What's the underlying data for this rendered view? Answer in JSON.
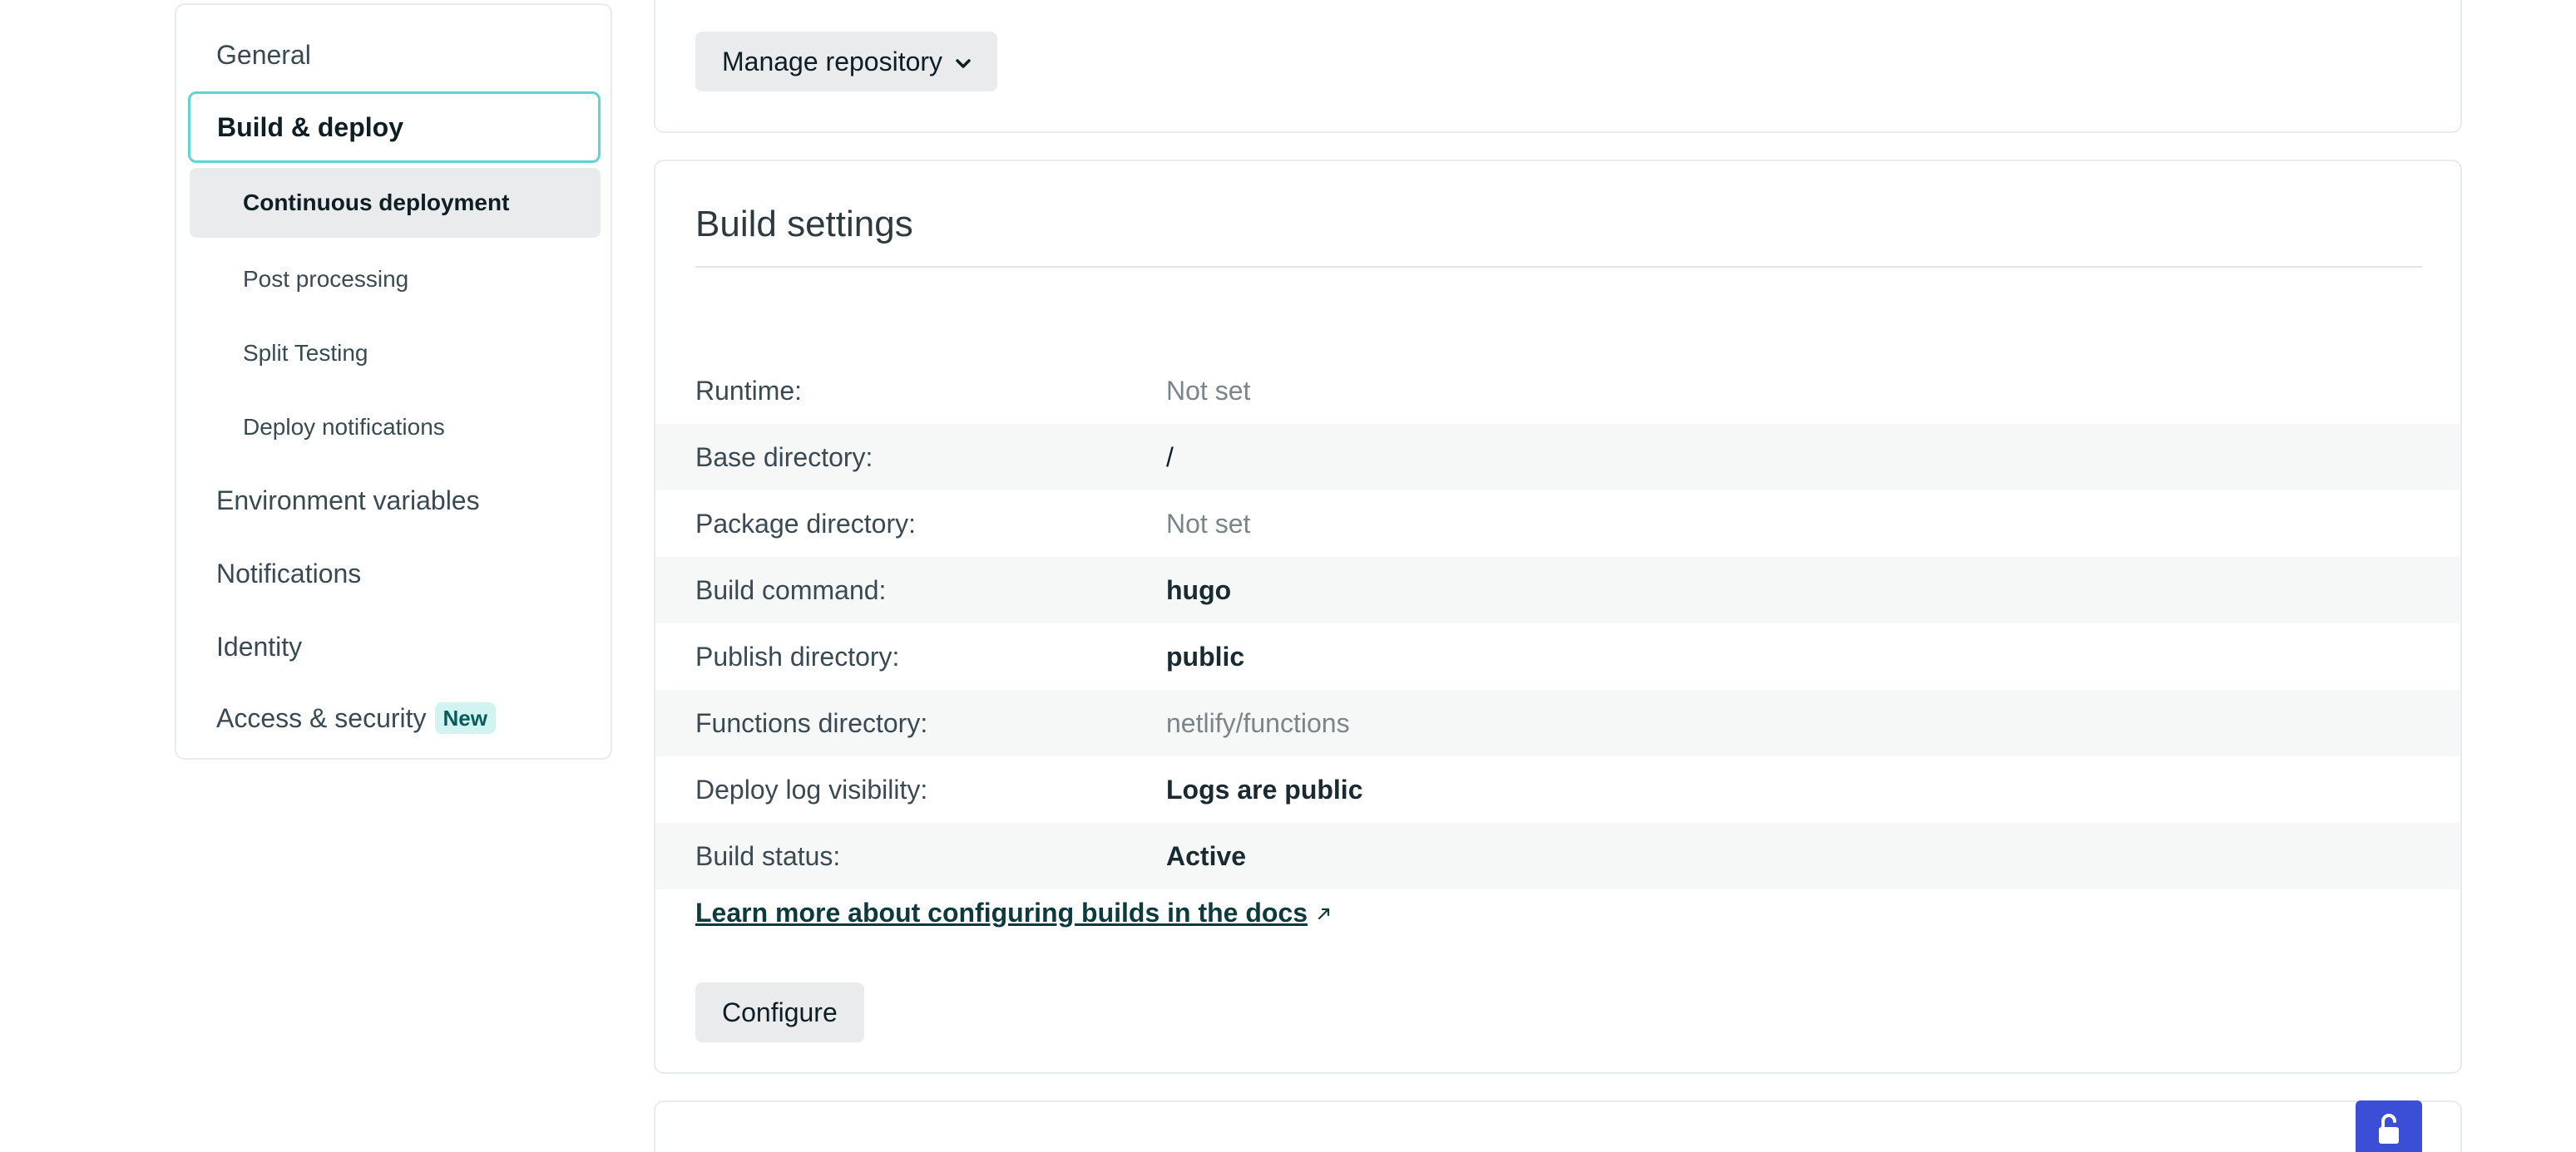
{
  "sidebar": {
    "general": "General",
    "build_deploy": "Build & deploy",
    "sub_items": [
      "Continuous deployment",
      "Post processing",
      "Split Testing",
      "Deploy notifications"
    ],
    "environment_variables": "Environment variables",
    "notifications": "Notifications",
    "identity": "Identity",
    "access_security": "Access & security",
    "new_badge": "New"
  },
  "repo_card": {
    "manage_button": "Manage repository"
  },
  "build_settings": {
    "title": "Build settings",
    "rows": [
      {
        "label": "Runtime:",
        "value": "Not set"
      },
      {
        "label": "Base directory:",
        "value": "/"
      },
      {
        "label": "Package directory:",
        "value": "Not set"
      },
      {
        "label": "Build command:",
        "value": "hugo"
      },
      {
        "label": "Publish directory:",
        "value": "public"
      },
      {
        "label": "Functions directory:",
        "value": "netlify/functions"
      },
      {
        "label": "Deploy log visibility:",
        "value": "Logs are public"
      },
      {
        "label": "Build status:",
        "value": "Active"
      }
    ],
    "docs_link": "Learn more about configuring builds in the docs",
    "configure_button": "Configure"
  },
  "colors": {
    "accent_border": "#5fd4d3",
    "badge_bg": "#d1f4f0",
    "lock_button": "#3b4fd6"
  },
  "icons": {
    "manage_chevron": "chevron-down-icon",
    "docs_arrow": "external-link-icon",
    "lock": "lock-icon"
  }
}
